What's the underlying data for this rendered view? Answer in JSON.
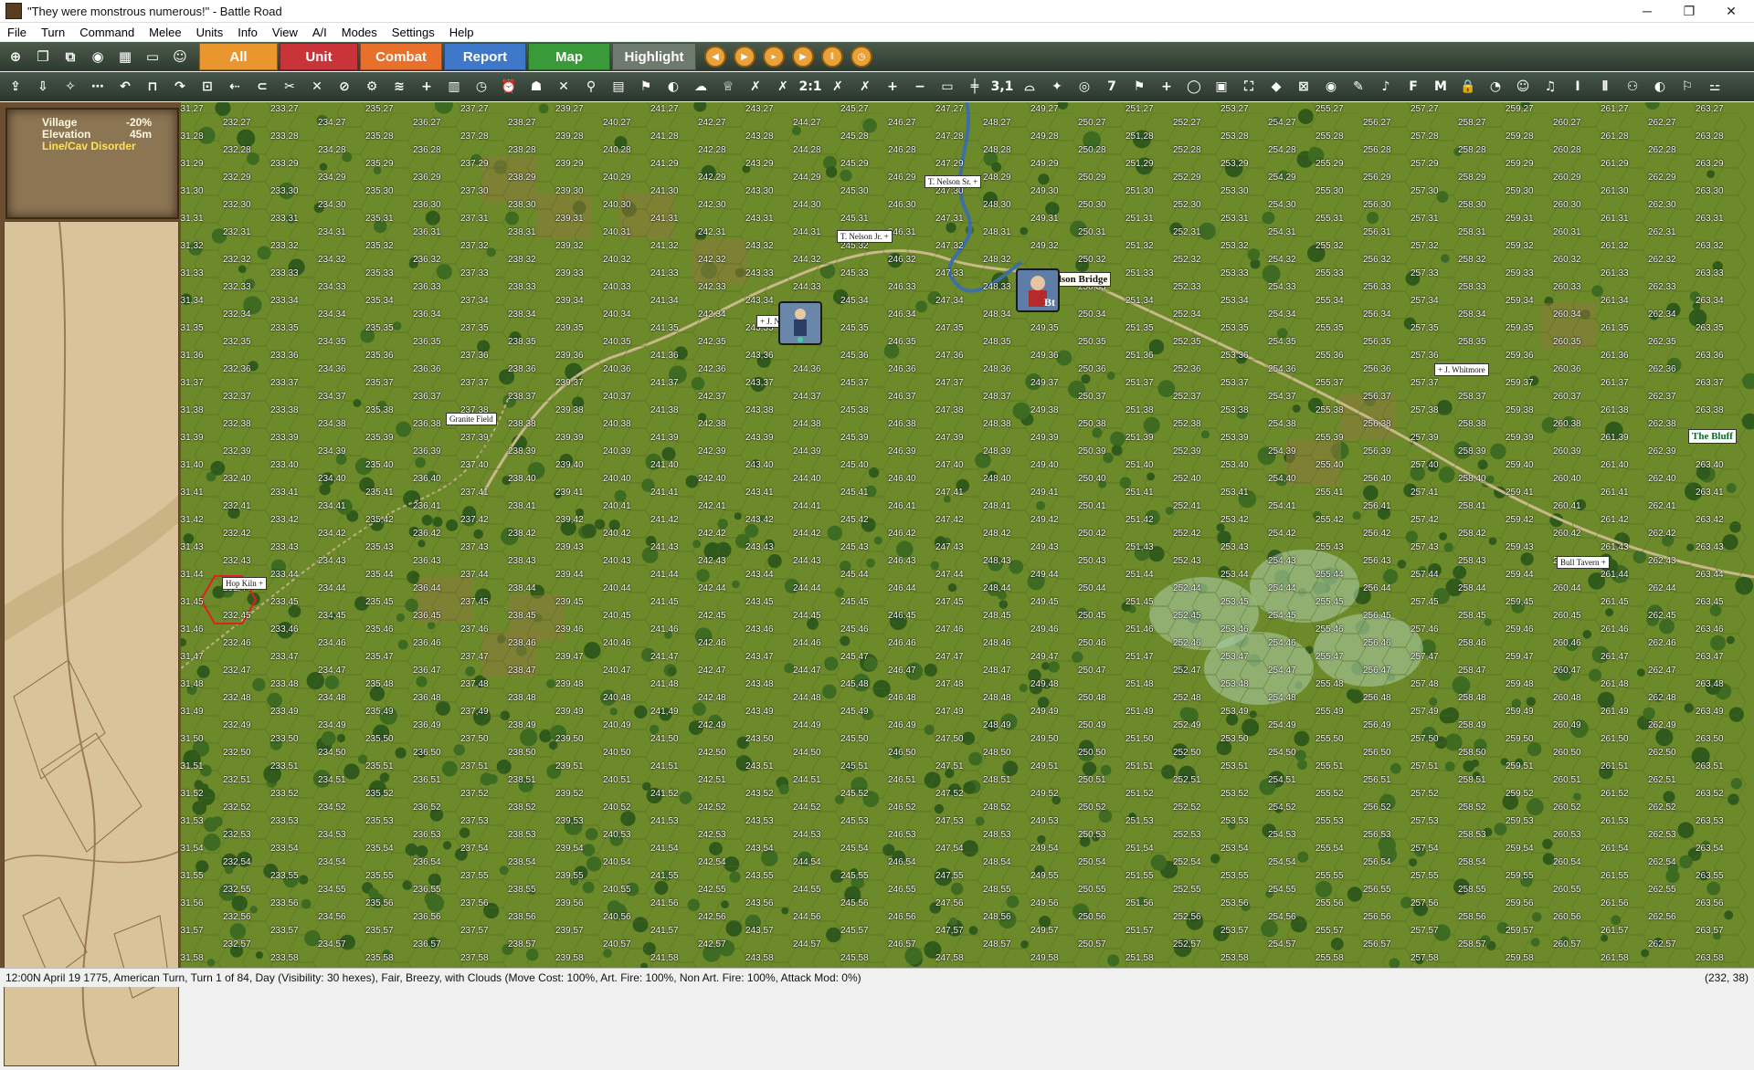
{
  "window": {
    "title": "\"They were monstrous numerous!\" - Battle Road",
    "minimize_glyph": "─",
    "maximize_glyph": "❐",
    "close_glyph": "✕"
  },
  "menu": [
    "File",
    "Turn",
    "Command",
    "Melee",
    "Units",
    "Info",
    "View",
    "A/I",
    "Modes",
    "Settings",
    "Help"
  ],
  "toolbar1": {
    "left_icons": [
      "target-icon",
      "copy-icon",
      "duplicate-icon",
      "eye-icon",
      "map-icon",
      "screen-icon",
      "portrait-icon"
    ],
    "mode_buttons": [
      {
        "label": "All",
        "color": "#e9962f"
      },
      {
        "label": "Unit",
        "color": "#c8343a"
      },
      {
        "label": "Combat",
        "color": "#e8702a"
      },
      {
        "label": "Report",
        "color": "#3f78c9"
      },
      {
        "label": "Map",
        "color": "#3a9a3a"
      },
      {
        "label": "Highlight",
        "color": "#6d7a6d"
      }
    ],
    "playback_icons": [
      "rewind-icon",
      "play-icon",
      "step-forward-icon",
      "fast-forward-icon",
      "pause-icon",
      "clock-icon"
    ]
  },
  "toolbar2": {
    "icons": [
      "⇪",
      "⇩",
      "✧",
      "⋯",
      "↶",
      "⊓",
      "↷",
      "⊡",
      "⇠",
      "⊂",
      "✂",
      "✕",
      "⊘",
      "⚙",
      "≋",
      "+",
      "▥",
      "◷",
      "⏰",
      "☗",
      "✕",
      "⚲",
      "▤",
      "⚑",
      "◐",
      "☁",
      "♕",
      "✗",
      "✗",
      "2:1",
      "✗",
      "✗",
      "+",
      "−",
      "▭",
      "╪",
      "3,1",
      "⌓",
      "✦",
      "◎",
      "7",
      "⚑",
      "+",
      "◯",
      "▣",
      "⛶",
      "◆",
      "⊠",
      "◉",
      "✎",
      "♪",
      "F",
      "M",
      "🔒",
      "◔",
      "☺",
      "♫",
      "I",
      "⫴",
      "⚇",
      "◐",
      "⚐",
      "⚍"
    ]
  },
  "terrain_info": {
    "rows": [
      {
        "key": "Village",
        "value": "-20%"
      },
      {
        "key": "Elevation",
        "value": "45m"
      }
    ],
    "disorder": "Line/Cav Disorder"
  },
  "map": {
    "col_start": 231,
    "row_start": 27,
    "place_labels": [
      {
        "text": "T. Nelson Sr. +",
        "style": "small"
      },
      {
        "text": "T. Nelson Jr. +",
        "style": "small"
      },
      {
        "text": "+ J. Nelson",
        "style": "small"
      },
      {
        "text": "+ Nelson Bridge",
        "style": "big"
      },
      {
        "text": "Granite Field",
        "style": "small"
      },
      {
        "text": "+ J. Whitmore",
        "style": "small"
      },
      {
        "text": "The Bluff",
        "style": "bluff"
      },
      {
        "text": "Bull Tavern +",
        "style": "small"
      },
      {
        "text": "Hop Kiln +",
        "style": "small"
      }
    ],
    "units": [
      {
        "name": "american-unit",
        "label": "243,31"
      },
      {
        "name": "british-unit",
        "label": "Bt"
      }
    ]
  },
  "statusbar": {
    "left": "12:00N  April 19 1775, American Turn, Turn 1 of 84, Day (Visibility: 30 hexes), Fair, Breezy, with Clouds (Move Cost: 100%, Art. Fire: 100%, Non Art. Fire: 100%, Attack Mod: 0%)",
    "right": "(232, 38)"
  }
}
